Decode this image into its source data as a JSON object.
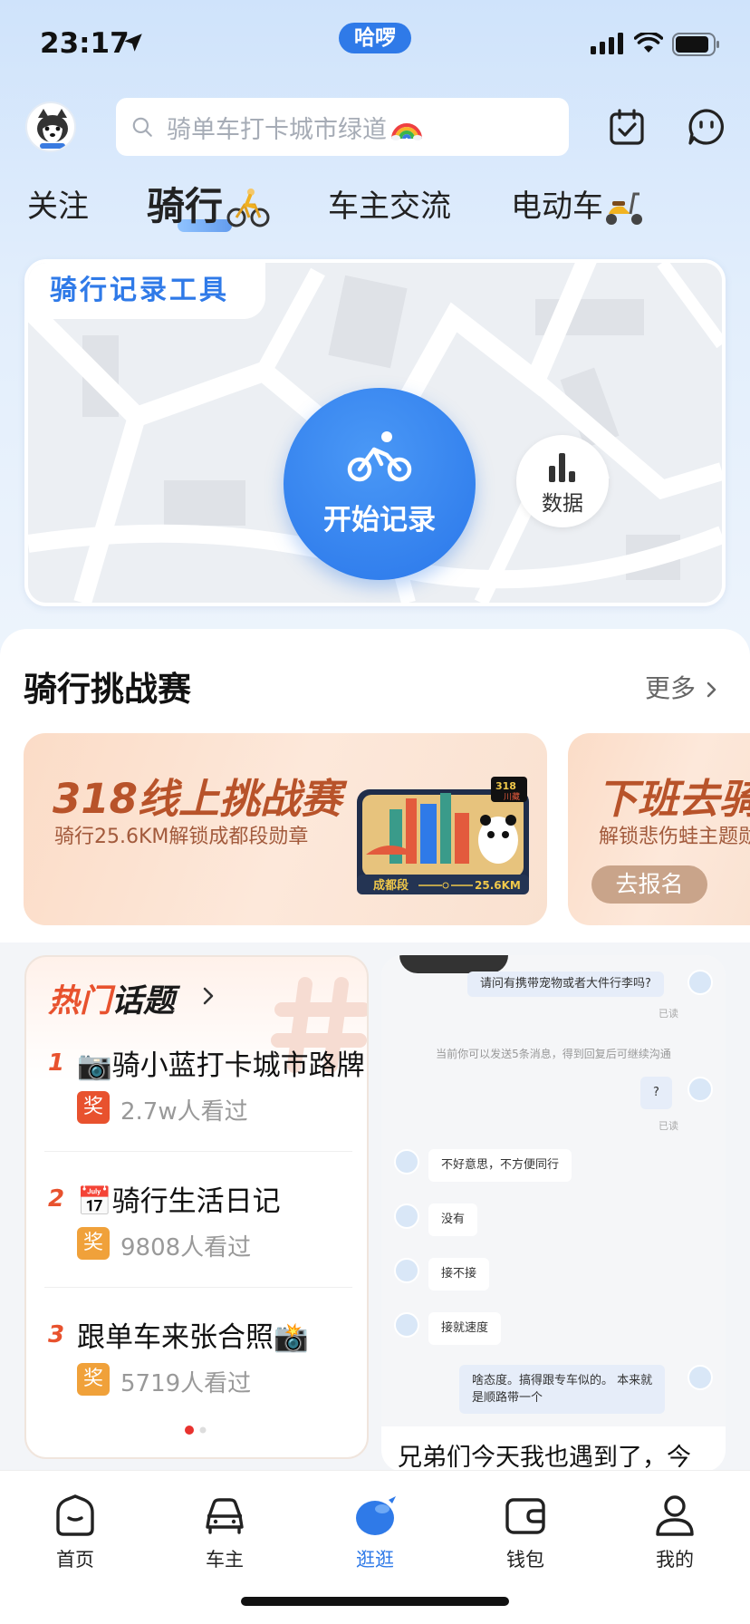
{
  "status_bar": {
    "time": "23:17",
    "pill": "哈啰"
  },
  "header": {
    "search_placeholder": "骑单车打卡城市绿道"
  },
  "tabs": [
    {
      "label": "关注",
      "active": false
    },
    {
      "label": "骑行",
      "active": true
    },
    {
      "label": "车主交流",
      "active": false
    },
    {
      "label": "电动车",
      "active": false
    }
  ],
  "ride_tool": {
    "label": "骑行记录工具",
    "start_label": "开始记录",
    "data_label": "数据"
  },
  "challenges": {
    "title": "骑行挑战赛",
    "more": "更多",
    "items": [
      {
        "title": "318线上挑战赛",
        "subtitle": "骑行25.6KM解锁成都段勋章",
        "medal_segment": "成都段",
        "medal_distance": "25.6KM",
        "medal_badge": "318",
        "medal_tag": "川藏"
      },
      {
        "title": "下班去骑",
        "subtitle": "解锁悲伤蛙主题勋",
        "button": "去报名"
      }
    ]
  },
  "hot_topics": {
    "title_hot": "热门",
    "title_rest": "话题",
    "items": [
      {
        "rank": "1",
        "emoji_before": "📷",
        "text": "骑小蓝打卡城市路牌",
        "emoji_after": "",
        "badge": "奖",
        "badge_color": "#e8522e",
        "views": "2.7w人看过"
      },
      {
        "rank": "2",
        "emoji_before": "📅",
        "text": "骑行生活日记",
        "emoji_after": "",
        "badge": "奖",
        "badge_color": "#f0a13a",
        "views": "9808人看过"
      },
      {
        "rank": "3",
        "emoji_before": "",
        "text": "跟单车来张合照",
        "emoji_after": "📸",
        "badge": "奖",
        "badge_color": "#f0a13a",
        "views": "5719人看过"
      }
    ]
  },
  "post": {
    "chat": {
      "m1": "请问有携带宠物或者大件行李吗?",
      "read1": "已读",
      "system": "当前你可以发送5条消息，得到回复后可继续沟通",
      "m2": "?",
      "read2": "已读",
      "r1": "不好意思，不方便同行",
      "r2": "没有",
      "r3": "接不接",
      "r4": "接就速度",
      "m3_line1": "啥态度。搞得跟专车似的。 本来就",
      "m3_line2": "是顺路带一个"
    },
    "caption": "兄弟们今天我也遇到了，今"
  },
  "tabbar": [
    {
      "label": "首页",
      "icon": "home-icon",
      "active": false
    },
    {
      "label": "车主",
      "icon": "car-icon",
      "active": false
    },
    {
      "label": "逛逛",
      "icon": "explore-icon",
      "active": true
    },
    {
      "label": "钱包",
      "icon": "wallet-icon",
      "active": false
    },
    {
      "label": "我的",
      "icon": "profile-icon",
      "active": false
    }
  ],
  "colors": {
    "accent": "#2f7ae8",
    "hot": "#e8522e",
    "badge_orange": "#f0a13a"
  }
}
